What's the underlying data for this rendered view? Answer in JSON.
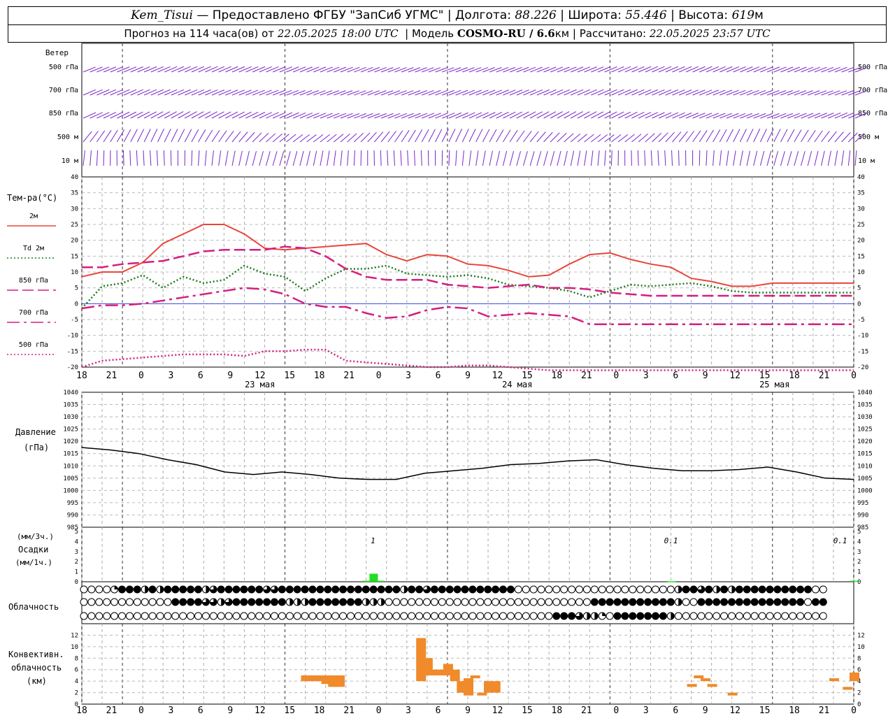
{
  "header": {
    "station": "Kem_Tisui",
    "provider": "Предоставлено ФГБУ \"ЗапСиб УГМС\"",
    "lon_label": "Долгота:",
    "lon": "88.226",
    "lat_label": "Широта:",
    "lat": "55.446",
    "alt_label": "Высота:",
    "alt": "619",
    "alt_unit": "м",
    "forecast_label": "Прогноз на 114 часа(ов) от",
    "forecast_time": "22.05.2025 18:00 UTC",
    "model_label": "Модель",
    "model": "COSMO-RU / 6.6",
    "model_unit": "км",
    "calc_label": "Рассчитано:",
    "calc_time": "22.05.2025 23:57 UTC"
  },
  "chart_data": [
    {
      "type": "wind_barbs",
      "title": "Ветер",
      "levels": [
        "500 гПа",
        "700 гПа",
        "850 гПа",
        "500 м",
        "10 м"
      ]
    },
    {
      "type": "line",
      "title": "Тем-ра(°С)",
      "ylim": [
        -20,
        40
      ],
      "yticks": [
        -20,
        -15,
        -10,
        -5,
        0,
        5,
        10,
        15,
        20,
        25,
        30,
        35,
        40
      ],
      "x_hours_from_start": [
        0,
        3,
        6,
        9,
        12,
        15,
        18,
        21,
        24,
        27,
        30,
        33,
        36,
        39,
        42,
        45,
        48,
        51,
        54,
        57,
        60,
        63,
        66,
        69,
        72,
        75,
        78,
        81,
        84,
        87,
        90,
        93,
        96,
        99,
        102,
        105,
        108,
        111,
        114,
        117
      ],
      "x_tick_labels": [
        "18",
        "21",
        "0",
        "3",
        "6",
        "9",
        "12",
        "15",
        "18",
        "21",
        "0",
        "3",
        "6",
        "9",
        "12",
        "15",
        "18",
        "21",
        "0",
        "3",
        "6",
        "9",
        "12",
        "15",
        "18",
        "21",
        "0"
      ],
      "day_labels": [
        "23 мая",
        "24 мая",
        "25 мая"
      ],
      "series": [
        {
          "name": "2м",
          "color": "#e8463a",
          "style": "solid",
          "values": [
            8.5,
            10,
            10,
            13,
            19,
            22,
            25,
            25,
            22,
            17.5,
            17,
            17.5,
            18,
            18.5,
            19,
            15.5,
            13.5,
            15.5,
            15,
            12.5,
            12,
            10.5,
            8.5,
            9,
            12.5,
            15.5,
            16,
            14,
            12.5,
            11.5,
            8,
            7,
            5.5,
            5.5,
            6.5,
            6.5,
            6.5,
            6.5,
            6.5,
            6.5
          ]
        },
        {
          "name": "Td 2м",
          "color": "#1d7a1d",
          "style": "dotted",
          "values": [
            -1.5,
            5.5,
            6.5,
            9,
            5,
            8.5,
            6.5,
            7.5,
            12,
            9.5,
            8.5,
            4,
            8,
            11,
            11,
            12,
            9.5,
            9,
            8.5,
            9,
            8,
            6,
            5.5,
            5,
            4,
            2,
            4,
            6,
            5.5,
            6,
            6.5,
            5.5,
            4,
            3.5,
            3.5,
            3.5,
            3.5,
            3.5,
            3.5,
            3.5
          ]
        },
        {
          "name": "850 гПа",
          "color": "#d61e7e",
          "style": "long-dash",
          "values": [
            11.5,
            11.5,
            12.5,
            13,
            13.5,
            15,
            16.5,
            17,
            17,
            17,
            18,
            17.5,
            15,
            11,
            8.5,
            7.5,
            7.5,
            7.5,
            6,
            5.5,
            5,
            5.5,
            6,
            5,
            5,
            4.5,
            3.5,
            3,
            2.5,
            2.5,
            2.5,
            2.5,
            2.5,
            2.5,
            2.5,
            2.5,
            2.5,
            2.5,
            2.5,
            2.5
          ]
        },
        {
          "name": "700 гПа",
          "color": "#d61e7e",
          "style": "dash-dot",
          "values": [
            -1.5,
            -0.5,
            -0.5,
            0,
            1,
            2,
            3,
            4,
            5,
            4.5,
            3,
            0,
            -1,
            -1,
            -3,
            -4.5,
            -4,
            -2,
            -1,
            -1.5,
            -4,
            -3.5,
            -3,
            -3.5,
            -4,
            -6.5,
            -6.5,
            -6.5,
            -6.5,
            -6.5,
            -6.5,
            -6.5,
            -6.5,
            -6.5,
            -6.5,
            -6.5,
            -6.5,
            -6.5,
            -6.5,
            -6.5
          ]
        },
        {
          "name": "500 гПа",
          "color": "#d61e7e",
          "style": "dotted",
          "values": [
            -20,
            -18,
            -17.5,
            -17,
            -16.5,
            -16,
            -16,
            -16,
            -16.5,
            -15,
            -15,
            -14.5,
            -14.5,
            -18,
            -18.5,
            -19,
            -19.5,
            -20,
            -20,
            -19.5,
            -19.5,
            -20,
            -20.5,
            -21,
            -21,
            -21,
            -21,
            -21,
            -21,
            -21,
            -21,
            -21,
            -21,
            -21,
            -21,
            -21,
            -21,
            -21,
            -21,
            -21
          ]
        }
      ]
    },
    {
      "type": "line",
      "title": "Давление",
      "ylabel": "(гПа)",
      "ylim": [
        985,
        1040
      ],
      "yticks": [
        985,
        990,
        995,
        1000,
        1005,
        1010,
        1015,
        1020,
        1025,
        1030,
        1035,
        1040
      ],
      "series": [
        {
          "name": "",
          "color": "#000000",
          "values": [
            1017.5,
            1016.5,
            1015,
            1012.5,
            1010.5,
            1007.5,
            1006.5,
            1007.5,
            1006.5,
            1005,
            1004.5,
            1004.5,
            1007,
            1008,
            1009,
            1010.5,
            1011,
            1012,
            1012.5,
            1010.5,
            1009,
            1008,
            1008,
            1008.5,
            1009.5,
            1007.5,
            1005,
            1004.5
          ]
        }
      ]
    },
    {
      "type": "bar",
      "title": "Осадки",
      "ylabel_top": "(мм/3ч.)",
      "ylabel_bottom": "(мм/1ч.)",
      "ylim": [
        0,
        5
      ],
      "yticks": [
        0,
        1,
        2,
        3,
        4,
        5
      ],
      "annotations": [
        "1",
        "0.1",
        "0.1"
      ],
      "values": [
        {
          "hour": 43,
          "value": 0.8
        },
        {
          "hour": 42,
          "value": 0.1
        },
        {
          "hour": 44,
          "value": 0.1
        },
        {
          "hour": 87,
          "value": 0.05
        },
        {
          "hour": 114,
          "value": 0.1
        }
      ]
    },
    {
      "type": "table",
      "title": "Облачность",
      "rows": 3,
      "legend": "circles: empty = clear, half/quarter fill = partial, full = overcast"
    },
    {
      "type": "bar",
      "title": "Конвективн. облачность (км)",
      "ylim": [
        0,
        14
      ],
      "yticks": [
        0,
        2,
        4,
        6,
        8,
        10,
        12
      ],
      "values": [
        {
          "hour": 33,
          "bottom": 4,
          "top": 5
        },
        {
          "hour": 34,
          "bottom": 4,
          "top": 5
        },
        {
          "hour": 35,
          "bottom": 4,
          "top": 5
        },
        {
          "hour": 36,
          "bottom": 3.5,
          "top": 5
        },
        {
          "hour": 37,
          "bottom": 3,
          "top": 5
        },
        {
          "hour": 38,
          "bottom": 3,
          "top": 5
        },
        {
          "hour": 50,
          "bottom": 4,
          "top": 11.5
        },
        {
          "hour": 51,
          "bottom": 5,
          "top": 8
        },
        {
          "hour": 52,
          "bottom": 5,
          "top": 6
        },
        {
          "hour": 53,
          "bottom": 5,
          "top": 6
        },
        {
          "hour": 54,
          "bottom": 5,
          "top": 7
        },
        {
          "hour": 55,
          "bottom": 4,
          "top": 6
        },
        {
          "hour": 56,
          "bottom": 2,
          "top": 4
        },
        {
          "hour": 57,
          "bottom": 1.5,
          "top": 4.5
        },
        {
          "hour": 58,
          "bottom": 4.5,
          "top": 5
        },
        {
          "hour": 59,
          "bottom": 1.5,
          "top": 2
        },
        {
          "hour": 60,
          "bottom": 2,
          "top": 4
        },
        {
          "hour": 61,
          "bottom": 2,
          "top": 4
        },
        {
          "hour": 90,
          "bottom": 3,
          "top": 3.5
        },
        {
          "hour": 91,
          "bottom": 4.5,
          "top": 5
        },
        {
          "hour": 92,
          "bottom": 4,
          "top": 4.5
        },
        {
          "hour": 93,
          "bottom": 3,
          "top": 3.5
        },
        {
          "hour": 96,
          "bottom": 1.5,
          "top": 2
        },
        {
          "hour": 111,
          "bottom": 4,
          "top": 4.5
        },
        {
          "hour": 113,
          "bottom": 2.5,
          "top": 3
        },
        {
          "hour": 114,
          "bottom": 4,
          "top": 5.5
        }
      ]
    }
  ]
}
